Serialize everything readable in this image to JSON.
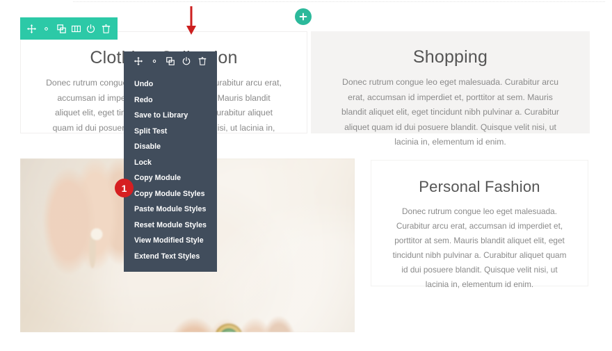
{
  "page": {
    "background_color": "#ffffff",
    "accent_green": "#2cc9a7",
    "menu_background": "#414d5c",
    "annotation_red": "#d61f21",
    "card_gray": "#f4f3f2"
  },
  "cards": {
    "clothing": {
      "title": "Clothing Collection",
      "body": "Donec rutrum congue leo eget malesuada. Curabitur arcu erat, accumsan id imperdiet et, porttitor at sem. Mauris blandit aliquet elit, eget tincidunt nibh pulvinar a. Curabitur aliquet quam id dui posuere blandit. Quisque velit nisi, ut lacinia in, elementum id enim."
    },
    "shopping": {
      "title": "Shopping",
      "body": "Donec rutrum congue leo eget malesuada. Curabitur arcu erat, accumsan id imperdiet et, porttitor at sem. Mauris blandit aliquet elit, eget tincidunt nibh pulvinar a. Curabitur aliquet quam id dui posuere blandit. Quisque velit nisi, ut lacinia in, elementum id enim."
    },
    "personal": {
      "title": "Personal Fashion",
      "body": "Donec rutrum congue leo eget malesuada. Curabitur arcu erat, accumsan id imperdiet et, porttitor at sem. Mauris blandit aliquet elit, eget tincidunt nibh pulvinar a. Curabitur aliquet quam id dui posuere blandit. Quisque velit nisi, ut lacinia in, elementum id enim."
    }
  },
  "green_toolbar": {
    "icons": [
      {
        "name": "move-handle-icon",
        "title": "Move"
      },
      {
        "name": "gear-icon",
        "title": "Settings"
      },
      {
        "name": "duplicate-icon",
        "title": "Duplicate"
      },
      {
        "name": "columns-icon",
        "title": "Change Column Structure"
      },
      {
        "name": "power-icon",
        "title": "Disable"
      },
      {
        "name": "trash-icon",
        "title": "Delete"
      }
    ]
  },
  "dark_toolbar": {
    "icons": [
      {
        "name": "move-handle-icon",
        "title": "Move"
      },
      {
        "name": "gear-icon",
        "title": "Settings"
      },
      {
        "name": "duplicate-icon",
        "title": "Duplicate"
      },
      {
        "name": "power-icon",
        "title": "Disable"
      },
      {
        "name": "trash-icon",
        "title": "Delete"
      }
    ]
  },
  "context_menu": {
    "items": [
      {
        "label": "Undo"
      },
      {
        "label": "Redo"
      },
      {
        "label": "Save to Library"
      },
      {
        "label": "Split Test"
      },
      {
        "label": "Disable"
      },
      {
        "label": "Lock"
      },
      {
        "label": "Copy Module"
      },
      {
        "label": "Copy Module Styles"
      },
      {
        "label": "Paste Module Styles"
      },
      {
        "label": "Reset Module Styles"
      },
      {
        "label": "View Modified Style"
      },
      {
        "label": "Extend Text Styles"
      }
    ]
  },
  "annotations": {
    "step_badge": "1",
    "arrow_direction": "down",
    "add_section_label": "+"
  }
}
